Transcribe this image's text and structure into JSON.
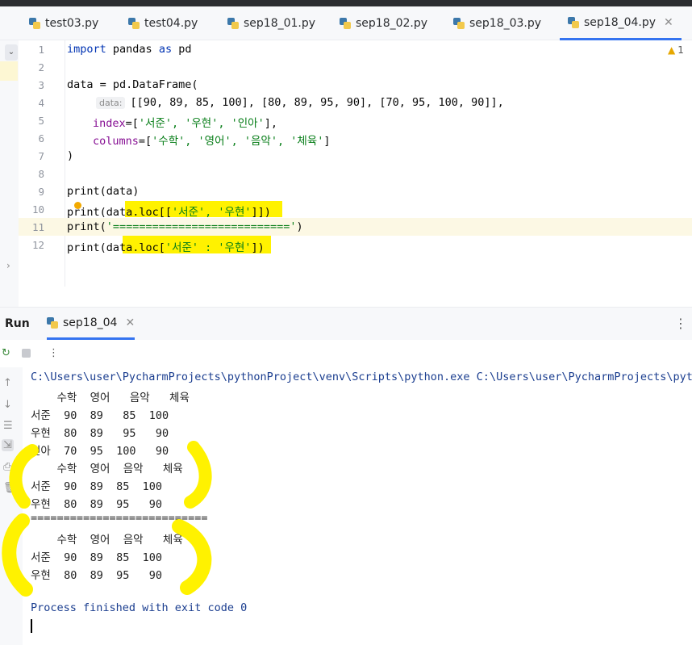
{
  "tabs": [
    {
      "label": "test03.py"
    },
    {
      "label": "test04.py"
    },
    {
      "label": "sep18_01.py"
    },
    {
      "label": "sep18_02.py"
    },
    {
      "label": "sep18_03.py"
    },
    {
      "label": "sep18_04.py",
      "active": true
    }
  ],
  "editor": {
    "warning_count": "1",
    "line_numbers": [
      "1",
      "2",
      "3",
      "4",
      "5",
      "6",
      "7",
      "8",
      "9",
      "10",
      "11",
      "12"
    ],
    "lines": {
      "l1_kw1": "import",
      "l1_mid": " pandas ",
      "l1_kw2": "as",
      "l1_end": " pd",
      "l3": "data = pd.DataFrame(",
      "l4_hint": "data:",
      "l4_code": "[[90, 89, 85, 100], [80, 89, 95, 90], [70, 95, 100, 90]],",
      "l5_param": "index",
      "l5_rest_a": "=[",
      "l5_strs": "'서준', '우현', '인아'",
      "l5_rest_b": "],",
      "l6_param": "columns",
      "l6_rest_a": "=[",
      "l6_strs": "'수학', '영어', '음악', '체육'",
      "l6_rest_b": "]",
      "l7": ")",
      "l9": "print(data)",
      "l10_a": "print(data.loc[[",
      "l10_strs": "'서준', '우현'",
      "l10_b": "]])",
      "l11_a": "print(",
      "l11_str": "'==========================='",
      "l11_b": ")",
      "l12_a": "print(data.loc[",
      "l12_strs": "'서준' : '우현'",
      "l12_b": "])"
    }
  },
  "run": {
    "title": "Run",
    "tab_label": "sep18_04",
    "output": [
      "C:\\Users\\user\\PycharmProjects\\pythonProject\\venv\\Scripts\\python.exe C:\\Users\\user\\PycharmProjects\\pytho",
      "    수학  영어   음악   체육",
      "서준  90  89   85  100",
      "우현  80  89   95   90",
      "인아  70  95  100   90",
      "    수학  영어  음악   체육",
      "서준  90  89  85  100",
      "우현  80  89  95   90",
      "===========================",
      "    수학  영어  음악   체육",
      "서준  90  89  85  100",
      "우현  80  89  95   90",
      "Process finished with exit code 0"
    ]
  },
  "colors": {
    "keyword": "#0033b3",
    "string": "#067d17",
    "param": "#871094",
    "highlight": "#fff200",
    "tab_active_underline": "#3574f0",
    "output_blue": "#1a3d8f"
  },
  "icons": [
    "python-file-icon",
    "close-icon",
    "warning-icon",
    "rerun-icon",
    "stop-icon",
    "more-vertical-icon",
    "up-arrow-icon",
    "down-arrow-icon",
    "soft-wrap-icon",
    "scroll-to-end-icon",
    "print-icon",
    "trash-icon"
  ]
}
